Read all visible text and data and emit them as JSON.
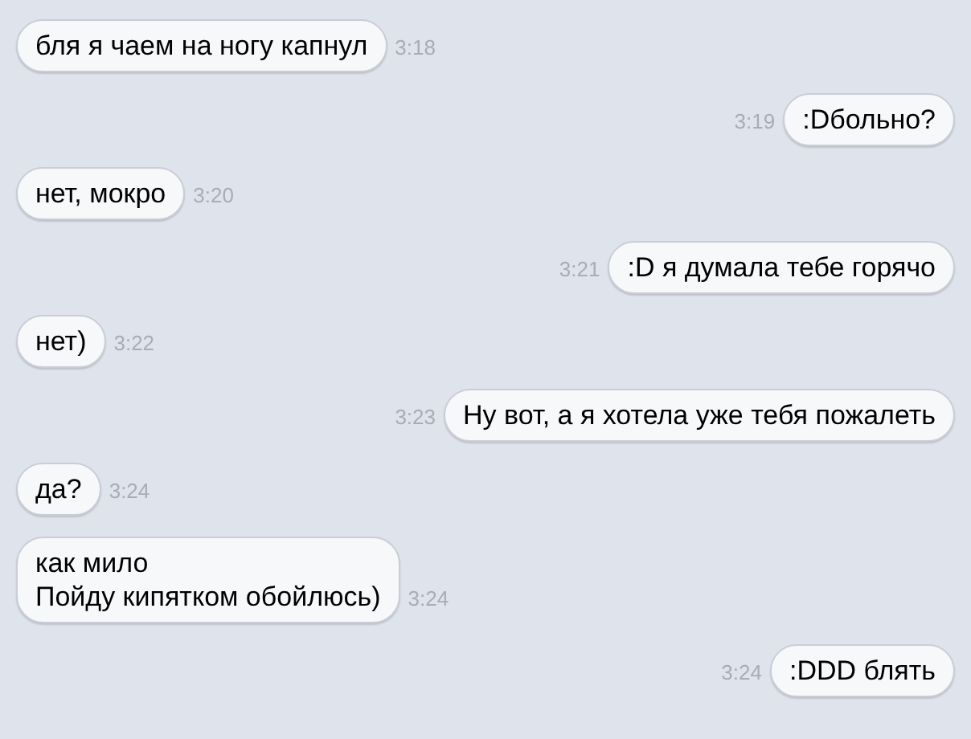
{
  "messages": [
    {
      "kind": "incoming",
      "text": "бля я чаем на ногу капнул",
      "time": "3:18"
    },
    {
      "kind": "outgoing",
      "text": ":Dбольно?",
      "time": "3:19"
    },
    {
      "kind": "incoming",
      "text": "нет, мокро",
      "time": "3:20"
    },
    {
      "kind": "outgoing",
      "text": ":D я думала тебе горячо",
      "time": "3:21"
    },
    {
      "kind": "incoming",
      "text": "нет)",
      "time": "3:22"
    },
    {
      "kind": "outgoing",
      "text": "Ну вот, а я хотела уже тебя пожалеть",
      "time": "3:23"
    },
    {
      "kind": "incoming",
      "text": "да?",
      "time": "3:24"
    },
    {
      "kind": "incoming",
      "text": "как мило\nПойду кипятком обойлюсь)",
      "time": "3:24"
    },
    {
      "kind": "outgoing",
      "text": ":DDD блять",
      "time": "3:24"
    }
  ]
}
